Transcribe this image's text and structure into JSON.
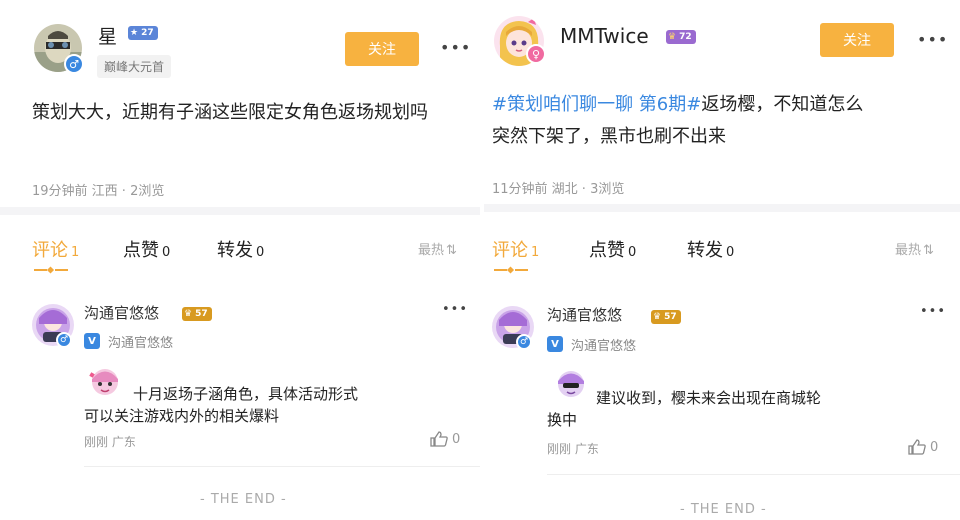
{
  "left": {
    "post": {
      "username": "星",
      "level": "27",
      "title": "巅峰大元首",
      "follow_label": "关注",
      "content": "策划大大，近期有子涵这些限定女角色返场规划吗",
      "meta": "19分钟前 江西 · 2浏览"
    },
    "tabs": {
      "comments": "评论",
      "comments_count": "1",
      "likes": "点赞",
      "likes_count": "0",
      "shares": "转发",
      "shares_count": "0",
      "sort": "最热"
    },
    "comment": {
      "username": "沟通官悠悠",
      "level": "57",
      "verify_text": "沟通官悠悠",
      "content_line1": "十月返场子涵角色，具体活动形式",
      "content_line2": "可以关注游戏内外的相关爆料",
      "meta": "刚刚  广东",
      "likes": "0"
    },
    "end_text": "- THE END -"
  },
  "right": {
    "post": {
      "username": "MMTwice",
      "level": "72",
      "follow_label": "关注",
      "tag": "#策划咱们聊一聊 第6期#",
      "content_rest": "返场樱，不知道怎么",
      "content_line2": "突然下架了，黑市也刷不出来",
      "meta": "11分钟前 湖北 · 3浏览"
    },
    "tabs": {
      "comments": "评论",
      "comments_count": "1",
      "likes": "点赞",
      "likes_count": "0",
      "shares": "转发",
      "shares_count": "0",
      "sort": "最热"
    },
    "comment": {
      "username": "沟通官悠悠",
      "level": "57",
      "verify_text": "沟通官悠悠",
      "content_line1": "建议收到，樱未来会出现在商城轮",
      "content_line2": "换中",
      "meta": "刚刚  广东",
      "likes": "0"
    },
    "end_text": "- THE END -"
  },
  "colors": {
    "accent": "#f7b240",
    "tag": "#3a88e0",
    "male": "#3a88e0",
    "female": "#f06aa0"
  }
}
